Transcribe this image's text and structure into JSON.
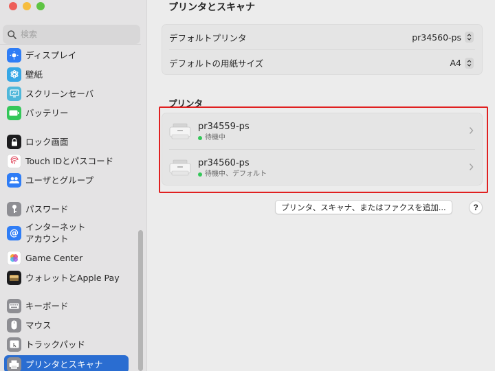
{
  "window": {
    "title": "プリンタとスキャナ"
  },
  "search": {
    "placeholder": "検索"
  },
  "sidebar": {
    "items": [
      {
        "label": "ディスプレイ",
        "icon": "display-icon",
        "color": "#2f7df6"
      },
      {
        "label": "壁紙",
        "icon": "wallpaper-icon",
        "color": "#36a7e6"
      },
      {
        "label": "スクリーンセーバ",
        "icon": "screensaver-icon",
        "color": "#4fb7da"
      },
      {
        "label": "バッテリー",
        "icon": "battery-icon",
        "color": "#34c759"
      },
      {
        "label": "ロック画面",
        "icon": "lock-icon",
        "color": "#1c1c1e"
      },
      {
        "label": "Touch IDとパスコード",
        "icon": "fingerprint-icon",
        "color": "#ffffff"
      },
      {
        "label": "ユーザとグループ",
        "icon": "users-icon",
        "color": "#2f7df6"
      },
      {
        "label": "パスワード",
        "icon": "key-icon",
        "color": "#8e8e93"
      },
      {
        "label": "インターネット\nアカウント",
        "line1": "インターネット",
        "line2": "アカウント",
        "icon": "at-icon",
        "color": "#2f7df6"
      },
      {
        "label": "Game Center",
        "icon": "game-center-icon",
        "color": "#ffffff"
      },
      {
        "label": "ウォレットとApple Pay",
        "icon": "wallet-icon",
        "color": "#1c1c1e"
      },
      {
        "label": "キーボード",
        "icon": "keyboard-icon",
        "color": "#8e8e93"
      },
      {
        "label": "マウス",
        "icon": "mouse-icon",
        "color": "#8e8e93"
      },
      {
        "label": "トラックパッド",
        "icon": "trackpad-icon",
        "color": "#8e8e93"
      },
      {
        "label": "プリンタとスキャナ",
        "icon": "printer-icon",
        "color": "#8e8e93",
        "selected": true
      }
    ]
  },
  "defaults": {
    "default_printer_label": "デフォルトプリンタ",
    "default_printer_value": "pr34560-ps",
    "paper_size_label": "デフォルトの用紙サイズ",
    "paper_size_value": "A4"
  },
  "printers": {
    "section_label": "プリンタ",
    "items": [
      {
        "name": "pr34559-ps",
        "status": "待機中"
      },
      {
        "name": "pr34560-ps",
        "status": "待機中、デフォルト"
      }
    ]
  },
  "actions": {
    "add_label": "プリンタ、スキャナ、またはファクスを追加...",
    "help_label": "?"
  },
  "colors": {
    "accent": "#2a6dd1",
    "highlight": "#e02020",
    "status_idle": "#34c759"
  }
}
